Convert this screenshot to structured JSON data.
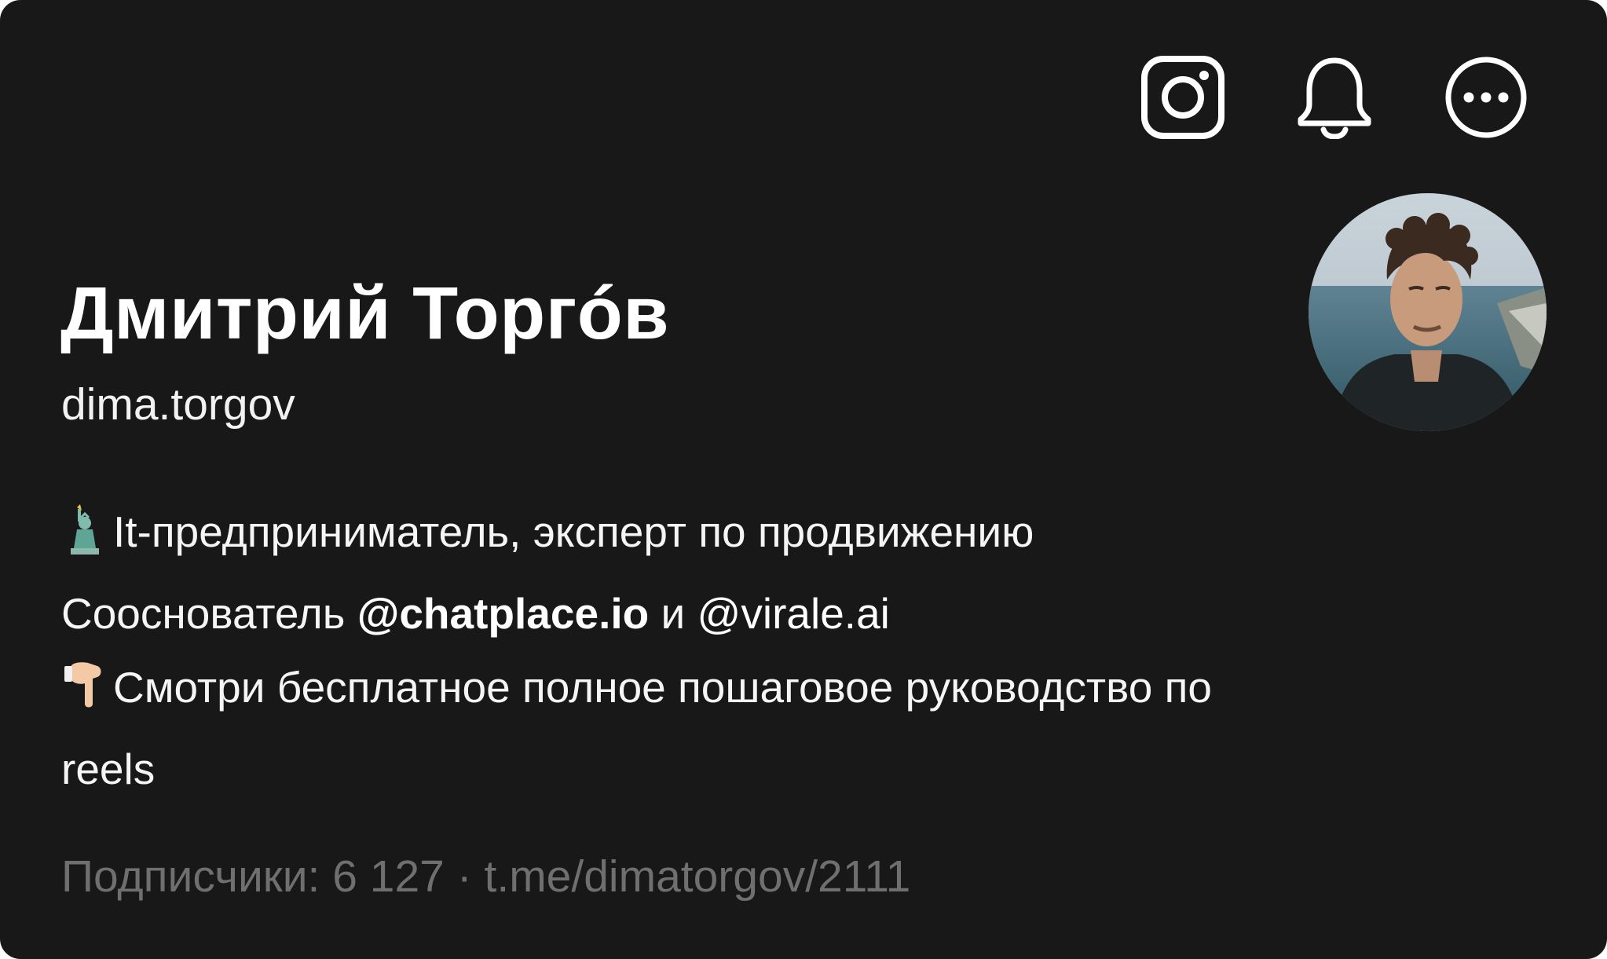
{
  "profile": {
    "name": "Дмитрий Торгóв",
    "username": "dima.torgov"
  },
  "actions": [
    {
      "icon": "instagram-icon",
      "label": "Instagram"
    },
    {
      "icon": "bell-icon",
      "label": "Notifications"
    },
    {
      "icon": "more-icon",
      "label": "More"
    }
  ],
  "bio": {
    "line1_emoji": "statue-of-liberty-emoji",
    "line1_text": "It-предприниматель, эксперт по продвижению",
    "line2_prefix": "Сооснователь ",
    "line2_mention1": "@chatplace.io",
    "line2_middle": " и ",
    "line2_mention2": "@virale.ai",
    "line3_emoji": "pointing-down-emoji",
    "line3_text": "Смотри бесплатное полное пошаговое руководство по",
    "line4_text": "reels"
  },
  "footer": {
    "subscribers_text": "Подписчики: 6 127",
    "separator": " · ",
    "link": "t.me/dimatorgov/2111"
  },
  "colors": {
    "background": "#181818",
    "text": "#ffffff",
    "muted": "#6f6f6f"
  }
}
